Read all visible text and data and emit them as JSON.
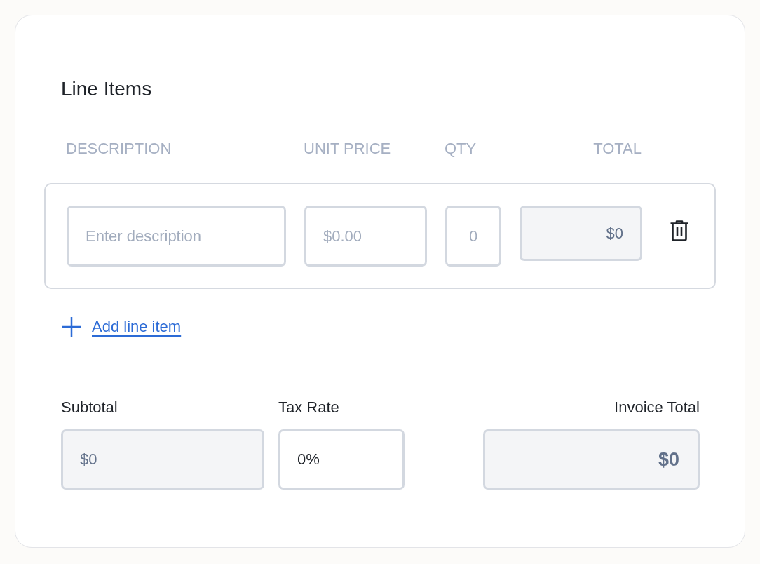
{
  "section": {
    "title": "Line Items"
  },
  "table": {
    "columns": [
      "DESCRIPTION",
      "UNIT PRICE",
      "QTY",
      "TOTAL"
    ],
    "rows": [
      {
        "description": {
          "placeholder": "Enter description",
          "readonly": false
        },
        "unit_price": {
          "placeholder": "$0.00",
          "readonly": false
        },
        "qty": {
          "placeholder": "0",
          "readonly": false
        },
        "total": {
          "value": "$0",
          "readonly": true
        }
      }
    ]
  },
  "add_link": {
    "label": "Add line item"
  },
  "summary": {
    "subtotal": {
      "label": "Subtotal",
      "value": "$0",
      "readonly": true
    },
    "tax_rate": {
      "label": "Tax Rate",
      "value": "0%",
      "readonly": false
    },
    "invoice_total": {
      "label": "Invoice Total",
      "value": "$0",
      "readonly": true
    }
  }
}
